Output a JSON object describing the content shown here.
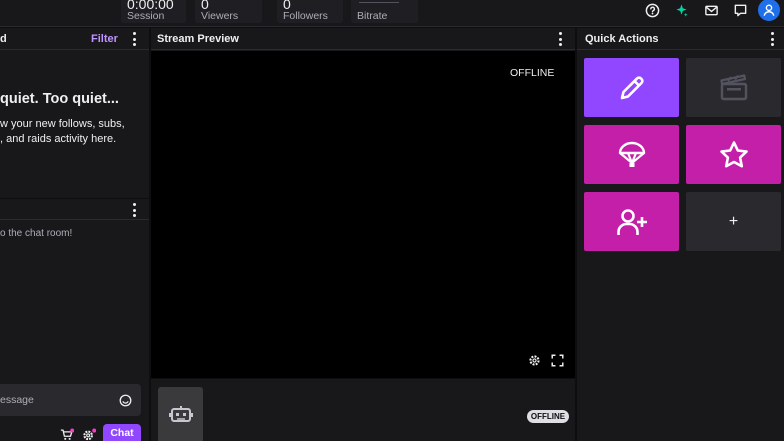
{
  "stats": [
    {
      "value": "0:00:00",
      "label": "Session"
    },
    {
      "value": "0",
      "label": "Viewers"
    },
    {
      "value": "0",
      "label": "Followers"
    },
    {
      "value": "",
      "label": "Bitrate"
    }
  ],
  "activity": {
    "filter_label": "Filter",
    "title_fragment": "d",
    "empty_title": "quiet. Too quiet...",
    "empty_text_line1": "w your new follows, subs,",
    "empty_text_line2": ", and raids activity here."
  },
  "chat": {
    "welcome": "o the chat room!",
    "input_placeholder": "essage",
    "send_label": "Chat"
  },
  "preview": {
    "title": "Stream Preview",
    "status": "OFFLINE",
    "badge": "OFFLINE"
  },
  "quick_actions": {
    "title": "Quick Actions",
    "add_label": "+",
    "colors": {
      "purple": "#9147ff",
      "magenta": "#c41fa9",
      "disabled": "#2a2a2e"
    }
  }
}
